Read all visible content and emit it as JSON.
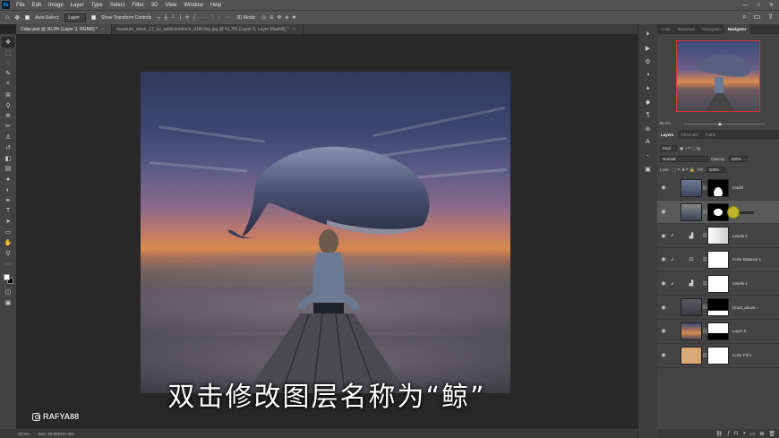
{
  "menubar": {
    "logo": "Ps",
    "items": [
      "File",
      "Edit",
      "Image",
      "Layer",
      "Type",
      "Select",
      "Filter",
      "3D",
      "View",
      "Window",
      "Help"
    ],
    "window_controls": [
      "—",
      "□",
      "✕"
    ]
  },
  "options": {
    "auto_select_label": "Auto-Select:",
    "auto_select_value": "Layer",
    "transform_label": "Show Transform Controls",
    "mode_3d_label": "3D Mode:"
  },
  "tabs": [
    {
      "label": "Cube.psd @ 30,3% (Layer 3, RGB/8) *",
      "close": "×"
    },
    {
      "label": "museum_stock_17_by_addictedstock_d18h3kp.jpg @ 41,3% (Layer 0, Layer Mask/8) *",
      "close": "×"
    }
  ],
  "subtitle": "双击修改图层名称为“鲸”",
  "watermark": "RAFYA88",
  "status": {
    "zoom": "30,3%",
    "doc": "Doc: 32,5M/127,4M"
  },
  "panels": {
    "top_tabs": [
      "Color",
      "Swatches",
      "Histogram",
      "Navigator"
    ],
    "nav_zoom": "30,3%",
    "layer_tabs": [
      "Layers",
      "Channels",
      "Paths"
    ],
    "kind": "Kind",
    "blend_mode": "Normal",
    "opacity_label": "Opacity:",
    "opacity_value": "100%",
    "lock_label": "Lock:",
    "fill_label": "Fill:",
    "fill_value": "100%"
  },
  "layers": [
    {
      "name": "model"
    },
    {
      "name": ""
    },
    {
      "name": "Levels 2"
    },
    {
      "name": "Color Balance 1"
    },
    {
      "name": "Levels 1"
    },
    {
      "name": "cloud_above..."
    },
    {
      "name": "Layer 2"
    },
    {
      "name": "Color Fill 1"
    }
  ]
}
